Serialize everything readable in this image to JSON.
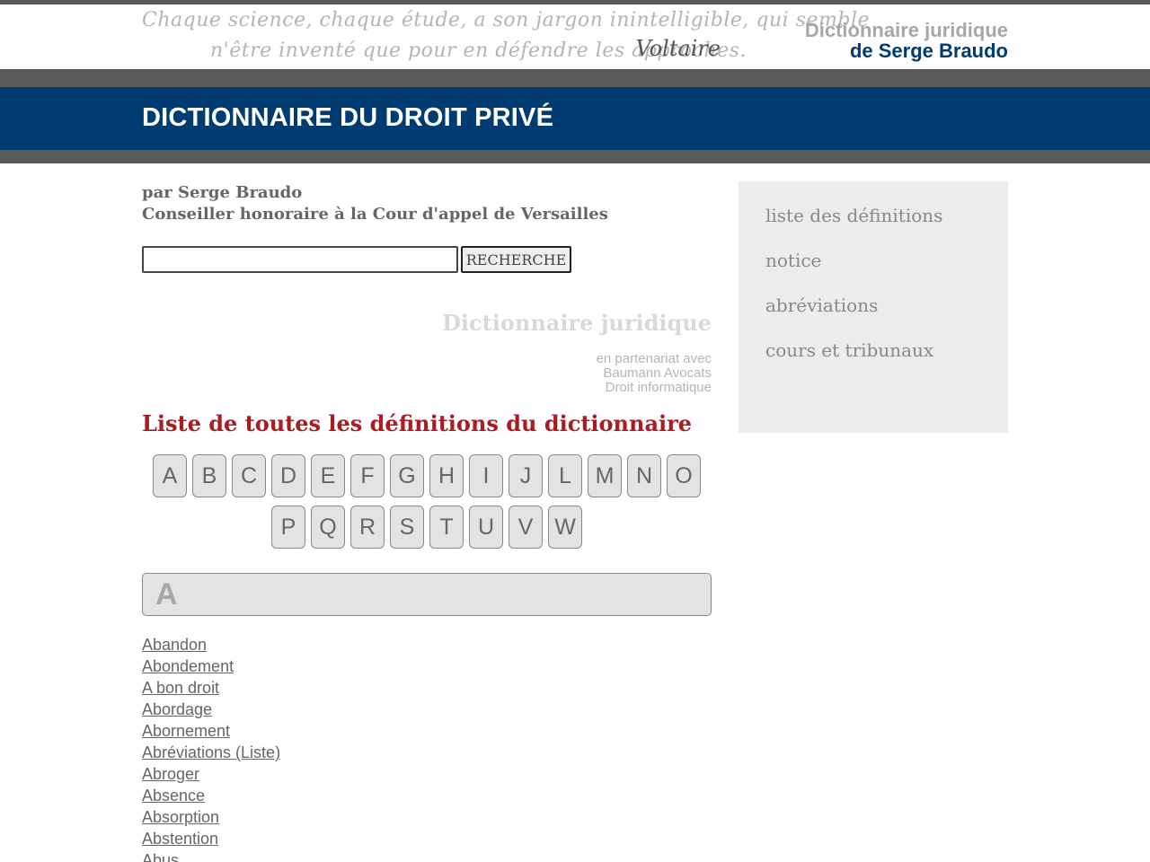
{
  "header": {
    "quote_line1": "Chaque science, chaque étude, a son jargon inintelligible, qui semble",
    "quote_line2": "n'être inventé que pour en défendre les approches.",
    "quote_author": "Voltaire",
    "brand_line1": "Dictionnaire juridique",
    "brand_line2": "de Serge Braudo"
  },
  "banner": {
    "title": "DICTIONNAIRE DU DROIT PRIVÉ"
  },
  "author": {
    "line1": "par Serge Braudo",
    "line2": "Conseiller honoraire à la Cour d'appel de Versailles"
  },
  "search": {
    "value": "",
    "button_label": "RECHERCHE"
  },
  "promo": {
    "title": "Dictionnaire juridique",
    "partner_lines": [
      "en partenariat avec",
      "Baumann Avocats",
      "Droit informatique"
    ]
  },
  "list": {
    "heading": "Liste de toutes les définitions du dictionnaire",
    "letters_row1": [
      "A",
      "B",
      "C",
      "D",
      "E",
      "F",
      "G",
      "H",
      "I",
      "J",
      "L",
      "M",
      "N",
      "O"
    ],
    "letters_row2": [
      "P",
      "Q",
      "R",
      "S",
      "T",
      "U",
      "V",
      "W"
    ],
    "current_letter": "A",
    "definitions": [
      "Abandon",
      "Abondement",
      "A bon droit",
      "Abordage",
      "Abornement",
      "Abréviations (Liste)",
      "Abroger",
      "Absence",
      "Absorption",
      "Abstention",
      "Abus"
    ]
  },
  "sidebar": {
    "items": [
      "liste des définitions",
      "notice",
      "abréviations",
      "cours et tribunaux"
    ]
  },
  "colors": {
    "banner_blue": "#003c71",
    "band_grey": "#58595b",
    "heading_red": "#a81c22"
  }
}
